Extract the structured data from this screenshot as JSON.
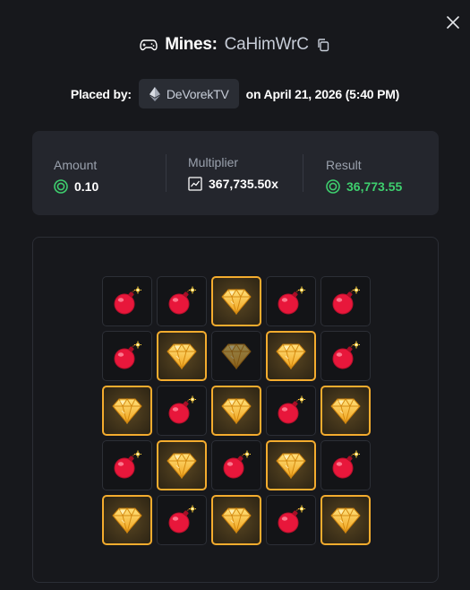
{
  "header": {
    "game_name": "Mines:",
    "bet_id": "CaHimWrC",
    "placed_by_label": "Placed by:",
    "username": "DeVorekTV",
    "date_text": "on April 21, 2026 (5:40 PM)"
  },
  "stats": {
    "amount_label": "Amount",
    "amount_value": "0.10",
    "multiplier_label": "Multiplier",
    "multiplier_value": "367,735.50x",
    "result_label": "Result",
    "result_value": "36,773.55"
  },
  "board": {
    "tiles": [
      {
        "type": "bomb",
        "picked": false
      },
      {
        "type": "bomb",
        "picked": false
      },
      {
        "type": "gem",
        "picked": true
      },
      {
        "type": "bomb",
        "picked": false
      },
      {
        "type": "bomb",
        "picked": false
      },
      {
        "type": "bomb",
        "picked": false
      },
      {
        "type": "gem",
        "picked": true
      },
      {
        "type": "gem",
        "picked": false
      },
      {
        "type": "gem",
        "picked": true
      },
      {
        "type": "bomb",
        "picked": false
      },
      {
        "type": "gem",
        "picked": true
      },
      {
        "type": "bomb",
        "picked": false
      },
      {
        "type": "gem",
        "picked": true
      },
      {
        "type": "bomb",
        "picked": false
      },
      {
        "type": "gem",
        "picked": true
      },
      {
        "type": "bomb",
        "picked": false
      },
      {
        "type": "gem",
        "picked": true
      },
      {
        "type": "bomb",
        "picked": false
      },
      {
        "type": "gem",
        "picked": true
      },
      {
        "type": "bomb",
        "picked": false
      },
      {
        "type": "gem",
        "picked": true
      },
      {
        "type": "bomb",
        "picked": false
      },
      {
        "type": "gem",
        "picked": true
      },
      {
        "type": "bomb",
        "picked": false
      },
      {
        "type": "gem",
        "picked": true
      }
    ]
  },
  "colors": {
    "background": "#17181c",
    "card": "#24262d",
    "accent_gold": "#f4ac2e",
    "result_green": "#3ecf6e",
    "bomb_red": "#e8173b"
  },
  "icons": {
    "close": "close-icon",
    "game": "gamepad-icon",
    "copy": "copy-icon",
    "currency": "ethereum-icon",
    "coin": "coin-icon",
    "multiplier": "chart-icon",
    "gem": "gem-icon",
    "bomb": "bomb-icon"
  }
}
